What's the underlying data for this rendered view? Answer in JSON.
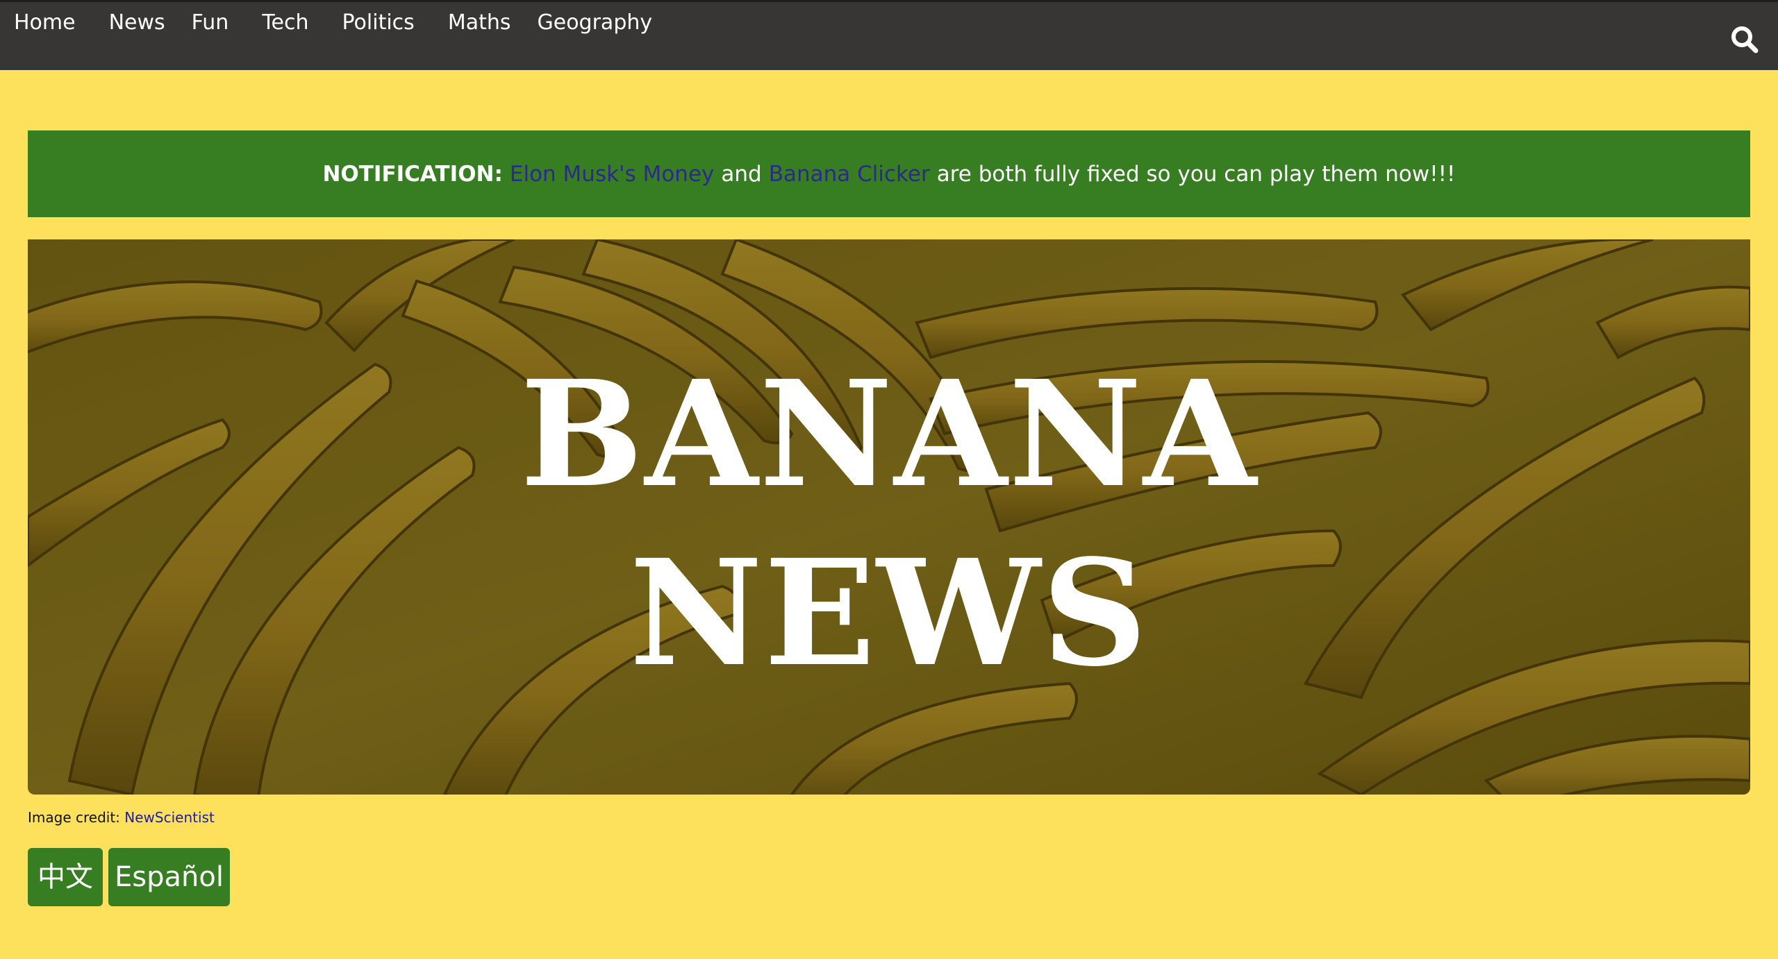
{
  "nav": {
    "items": [
      {
        "label": "Home"
      },
      {
        "label": "News"
      },
      {
        "label": "Fun"
      },
      {
        "label": "Tech"
      },
      {
        "label": "Politics"
      },
      {
        "label": "Maths"
      },
      {
        "label": "Geography"
      }
    ],
    "search_icon": "search-icon"
  },
  "notification": {
    "prefix": "NOTIFICATION:",
    "link1": "Elon Musk's Money",
    "middle": "and",
    "link2": "Banana Clicker",
    "suffix": "are both fully fixed so you can play them now!!!"
  },
  "hero": {
    "line1": "BANANA",
    "line2": "NEWS"
  },
  "credit": {
    "label": "Image credit:",
    "link": "NewScientist"
  },
  "languages": [
    {
      "label": "中文"
    },
    {
      "label": "Español"
    }
  ],
  "colors": {
    "page_bg": "#fde15c",
    "topbar": "#383634",
    "accent_green": "#377e22",
    "link_purple": "#2b2a8c"
  }
}
